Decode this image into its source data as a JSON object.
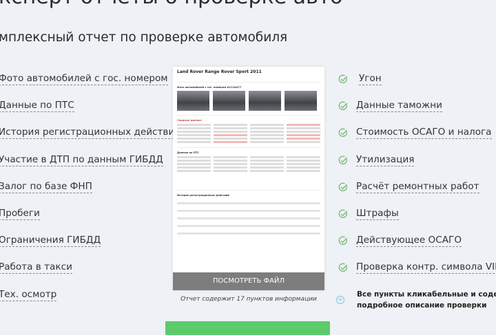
{
  "header": {
    "title": "ксперт отчеты о проверке авто",
    "subtitle": "мплексный отчет по проверке автомобиля"
  },
  "left_items": [
    "Фото автомобилей с гос. номером",
    "Данные по ПТС",
    "История регистрационных действий",
    "Участие в ДТП по данным ГИБДД",
    "Залог по базе ФНП",
    "Пробеги",
    "Ограничения ГИБДД",
    "Работа в такси",
    "Тех. осмотр"
  ],
  "right_items": [
    "Угон",
    "Данные таможни",
    "Стоимость ОСАГО и налога",
    "Утилизация",
    "Расчёт ремонтных работ",
    "Штрафы",
    "Действующее ОСАГО",
    "Проверка контр. символа VIN"
  ],
  "note": {
    "line1": "Все пункты кликабельные и содержат",
    "line2": "подробное описание проверки"
  },
  "report": {
    "car": "Land Rover Range Rover Sport 2011",
    "photos_section": "Фото автомобилей с гос. номером А111АА77",
    "summary_section": "Сводные данные",
    "pts_section": "Данные по ПТС",
    "history_section": "История регистрационных действий",
    "view_button": "ПОСМОТРЕТЬ ФАЙЛ",
    "caption": "Отчет содержит 17 пунктов информации"
  },
  "colors": {
    "check": "#7dbb7d",
    "accent_green": "#5ccb6a",
    "button_gray": "#7d7d7d"
  }
}
